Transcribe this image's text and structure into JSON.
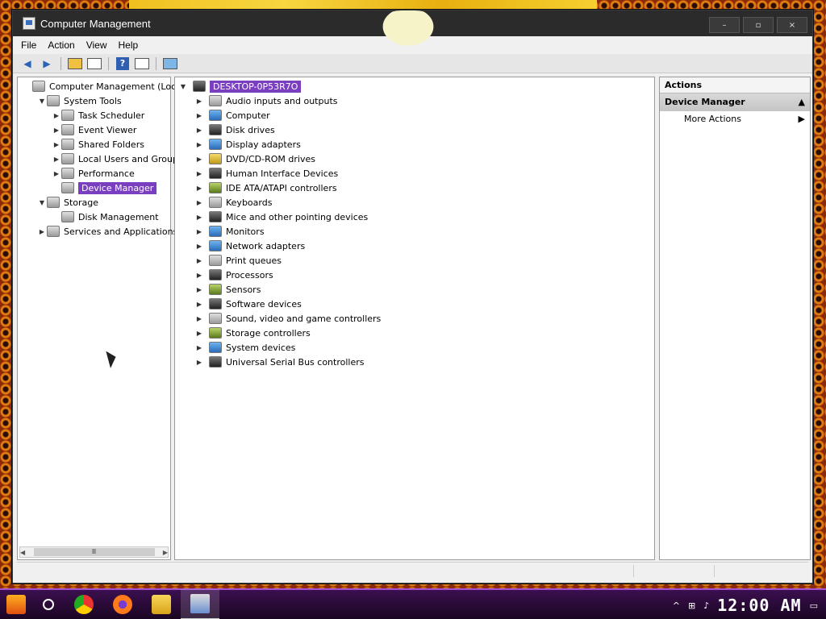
{
  "window": {
    "title": "Computer Management",
    "minimize": "–",
    "maximize": "▫",
    "close": "×"
  },
  "menu": [
    "File",
    "Action",
    "View",
    "Help"
  ],
  "toolbar_icons": [
    "back-arrow-icon",
    "forward-arrow-icon",
    "up-folder-icon",
    "show-hide-tree-icon",
    "help-icon",
    "properties-icon",
    "monitor-icon"
  ],
  "left_tree": [
    {
      "label": "Computer Management (Local)",
      "indent": 0,
      "arrow": "",
      "icon": "computer-management-icon"
    },
    {
      "label": "System Tools",
      "indent": 1,
      "arrow": "▼",
      "icon": "tools-icon"
    },
    {
      "label": "Task Scheduler",
      "indent": 2,
      "arrow": "▶",
      "icon": "clock-icon"
    },
    {
      "label": "Event Viewer",
      "indent": 2,
      "arrow": "▶",
      "icon": "event-viewer-icon"
    },
    {
      "label": "Shared Folders",
      "indent": 2,
      "arrow": "▶",
      "icon": "shared-folders-icon"
    },
    {
      "label": "Local Users and Groups",
      "indent": 2,
      "arrow": "▶",
      "icon": "users-icon"
    },
    {
      "label": "Performance",
      "indent": 2,
      "arrow": "▶",
      "icon": "performance-icon"
    },
    {
      "label": "Device Manager",
      "indent": 2,
      "arrow": "",
      "icon": "device-manager-icon",
      "selected": true
    },
    {
      "label": "Storage",
      "indent": 1,
      "arrow": "▼",
      "icon": "storage-icon"
    },
    {
      "label": "Disk Management",
      "indent": 2,
      "arrow": "",
      "icon": "disk-management-icon"
    },
    {
      "label": "Services and Applications",
      "indent": 1,
      "arrow": "▶",
      "icon": "services-icon"
    }
  ],
  "device_root": "DESKTOP-0P53R7O",
  "devices": [
    {
      "label": "Audio inputs and outputs",
      "icon": "speaker-icon"
    },
    {
      "label": "Computer",
      "icon": "monitor-icon"
    },
    {
      "label": "Disk drives",
      "icon": "disk-drive-icon"
    },
    {
      "label": "Display adapters",
      "icon": "display-adapter-icon"
    },
    {
      "label": "DVD/CD-ROM drives",
      "icon": "dvd-icon"
    },
    {
      "label": "Human Interface Devices",
      "icon": "hid-icon"
    },
    {
      "label": "IDE ATA/ATAPI controllers",
      "icon": "ide-controller-icon"
    },
    {
      "label": "Keyboards",
      "icon": "keyboard-icon"
    },
    {
      "label": "Mice and other pointing devices",
      "icon": "mouse-icon"
    },
    {
      "label": "Monitors",
      "icon": "monitor-icon"
    },
    {
      "label": "Network adapters",
      "icon": "network-adapter-icon"
    },
    {
      "label": "Print queues",
      "icon": "printer-icon"
    },
    {
      "label": "Processors",
      "icon": "processor-icon"
    },
    {
      "label": "Sensors",
      "icon": "sensor-icon"
    },
    {
      "label": "Software devices",
      "icon": "software-device-icon"
    },
    {
      "label": "Sound, video and game controllers",
      "icon": "speaker-icon"
    },
    {
      "label": "Storage controllers",
      "icon": "storage-controller-icon"
    },
    {
      "label": "System devices",
      "icon": "system-device-icon"
    },
    {
      "label": "Universal Serial Bus controllers",
      "icon": "usb-icon"
    }
  ],
  "actions": {
    "header": "Actions",
    "section": "Device Manager",
    "more": "More Actions"
  },
  "taskbar": {
    "apps": [
      "start-icon",
      "search-icon",
      "chrome-icon",
      "firefox-icon",
      "file-explorer-icon",
      "computer-management-icon"
    ],
    "clock": "12:00 AM"
  },
  "colors": {
    "selection": "#7a3fc0",
    "taskbar": "#2a0a38",
    "titlebar": "#2b2b2b"
  }
}
